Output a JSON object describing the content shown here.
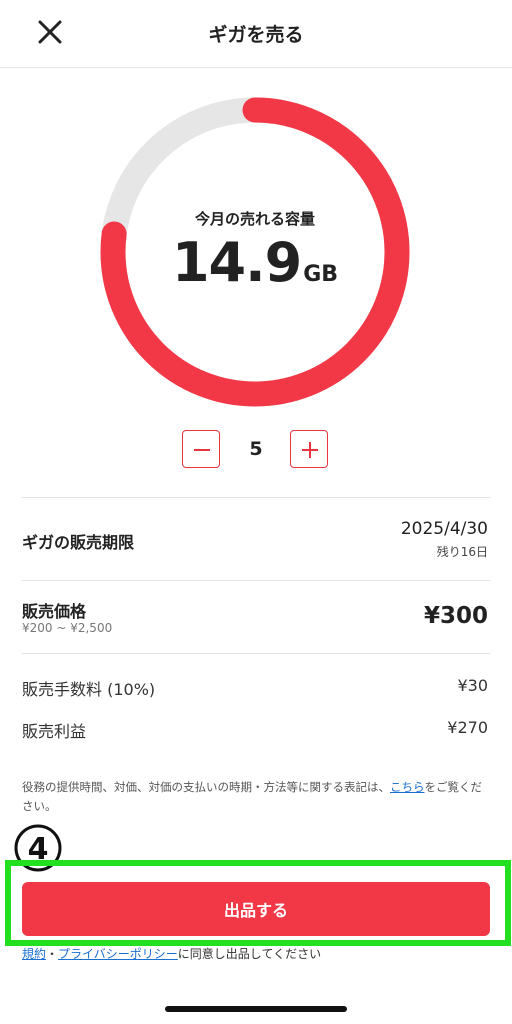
{
  "header": {
    "title": "ギガを売る"
  },
  "capacity": {
    "label": "今月の売れる容量",
    "value": "14.9",
    "unit": "GB",
    "fill_fraction": 0.77
  },
  "stepper": {
    "value": "5"
  },
  "sale_deadline": {
    "label": "ギガの販売期限",
    "date": "2025/4/30",
    "remaining": "残り16日"
  },
  "price": {
    "label": "販売価格",
    "range": "¥200 ~ ¥2,500",
    "value": "¥300"
  },
  "fee": {
    "label": "販売手数料 (10%)",
    "value": "¥30"
  },
  "profit": {
    "label": "販売利益",
    "value": "¥270"
  },
  "notice": {
    "text_before": "役務の提供時間、対価、対価の支払いの時期・方法等に関する表記は、",
    "link": "こちら",
    "text_after": "をご覧ください。"
  },
  "step_badge": {
    "label": "④"
  },
  "submit": {
    "label": "出品する"
  },
  "terms": {
    "link_terms": "規約",
    "separator": "・",
    "link_privacy": "プライバシーポリシー",
    "text_after": "に同意し出品してください"
  },
  "colors": {
    "accent": "#f23847",
    "ring_track": "#e6e6e6",
    "highlight": "#22e01f",
    "link": "#1a6fd0"
  }
}
